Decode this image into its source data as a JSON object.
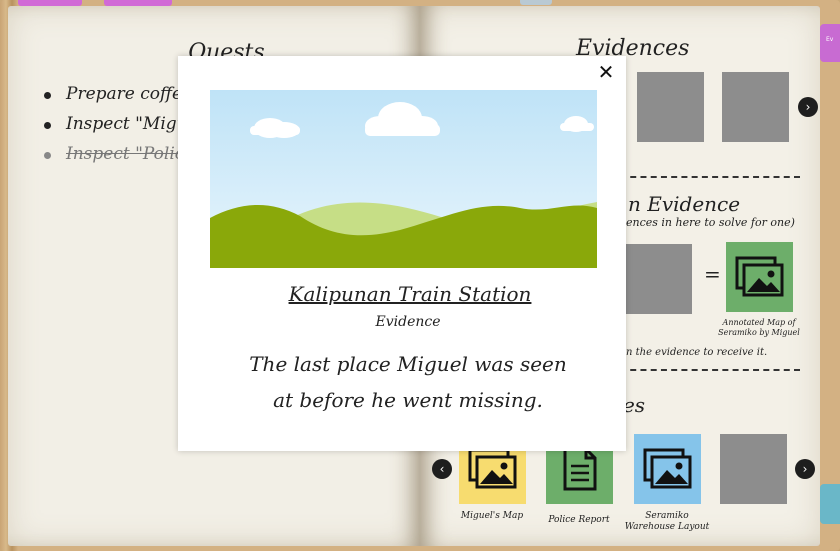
{
  "quests": {
    "heading": "Quests",
    "items": [
      {
        "label": "Prepare coffe",
        "done": false
      },
      {
        "label": "Inspect \"Migu",
        "done": false
      },
      {
        "label": "Inspect \"Polic",
        "done": true
      }
    ]
  },
  "evidences": {
    "heading": "Evidences",
    "next_icon": "chevron-right-icon"
  },
  "combine": {
    "heading": "n Evidence",
    "hint": "ences in here to solve for one)",
    "equals": "=",
    "result_label": "Annotated Map of Seramiko by Miguel",
    "footer": "n the evidence to receive it."
  },
  "items_section": {
    "heading": "mes",
    "items": [
      {
        "label": "Miguel's Map",
        "color": "#f7dc6f",
        "icon": "image-icon"
      },
      {
        "label": "Police Report",
        "color": "#6dae6a",
        "icon": "document-icon"
      },
      {
        "label": "Seramiko Warehouse Layout",
        "color": "#85c4ea",
        "icon": "image-icon"
      }
    ]
  },
  "modal": {
    "title": "Kalipunan Train Station",
    "subtitle": "Evidence",
    "description": "The last place Miguel was seen at before he went missing.",
    "close_icon": "close-icon"
  },
  "side_tab": {
    "label": "Ev"
  },
  "colors": {
    "sky": "#c7e6f7",
    "hill_dark": "#8aa80a",
    "hill_light": "#c6de86",
    "placeholder_gray": "#8d8d8d"
  }
}
